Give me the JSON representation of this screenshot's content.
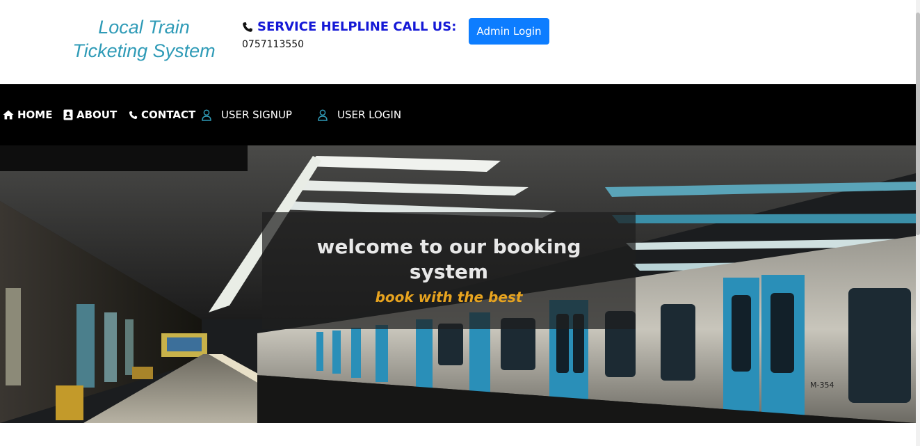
{
  "header": {
    "brand_line1": "Local Train",
    "brand_line2": "Ticketing System",
    "helpline_label": "SERVICE HELPLINE CALL US:",
    "helpline_number": "0757113550",
    "admin_login_label": "Admin Login"
  },
  "nav": {
    "items": [
      {
        "label": "HOME",
        "icon": "home-icon"
      },
      {
        "label": "ABOUT",
        "icon": "contact-card-icon"
      },
      {
        "label": "CONTACT",
        "icon": "phone-icon"
      },
      {
        "label": "USER SIGNUP",
        "icon": "user-icon"
      },
      {
        "label": "USER LOGIN",
        "icon": "user-icon"
      }
    ]
  },
  "hero": {
    "title": "welcome to our booking system",
    "subtitle": "book with the best"
  },
  "colors": {
    "brand": "#2f9bb7",
    "helpline": "#1418d6",
    "primary_button": "#0d7dff",
    "nav_bg": "#000000",
    "subtitle": "#e8a41f",
    "user_icon": "#2f9bb7"
  }
}
